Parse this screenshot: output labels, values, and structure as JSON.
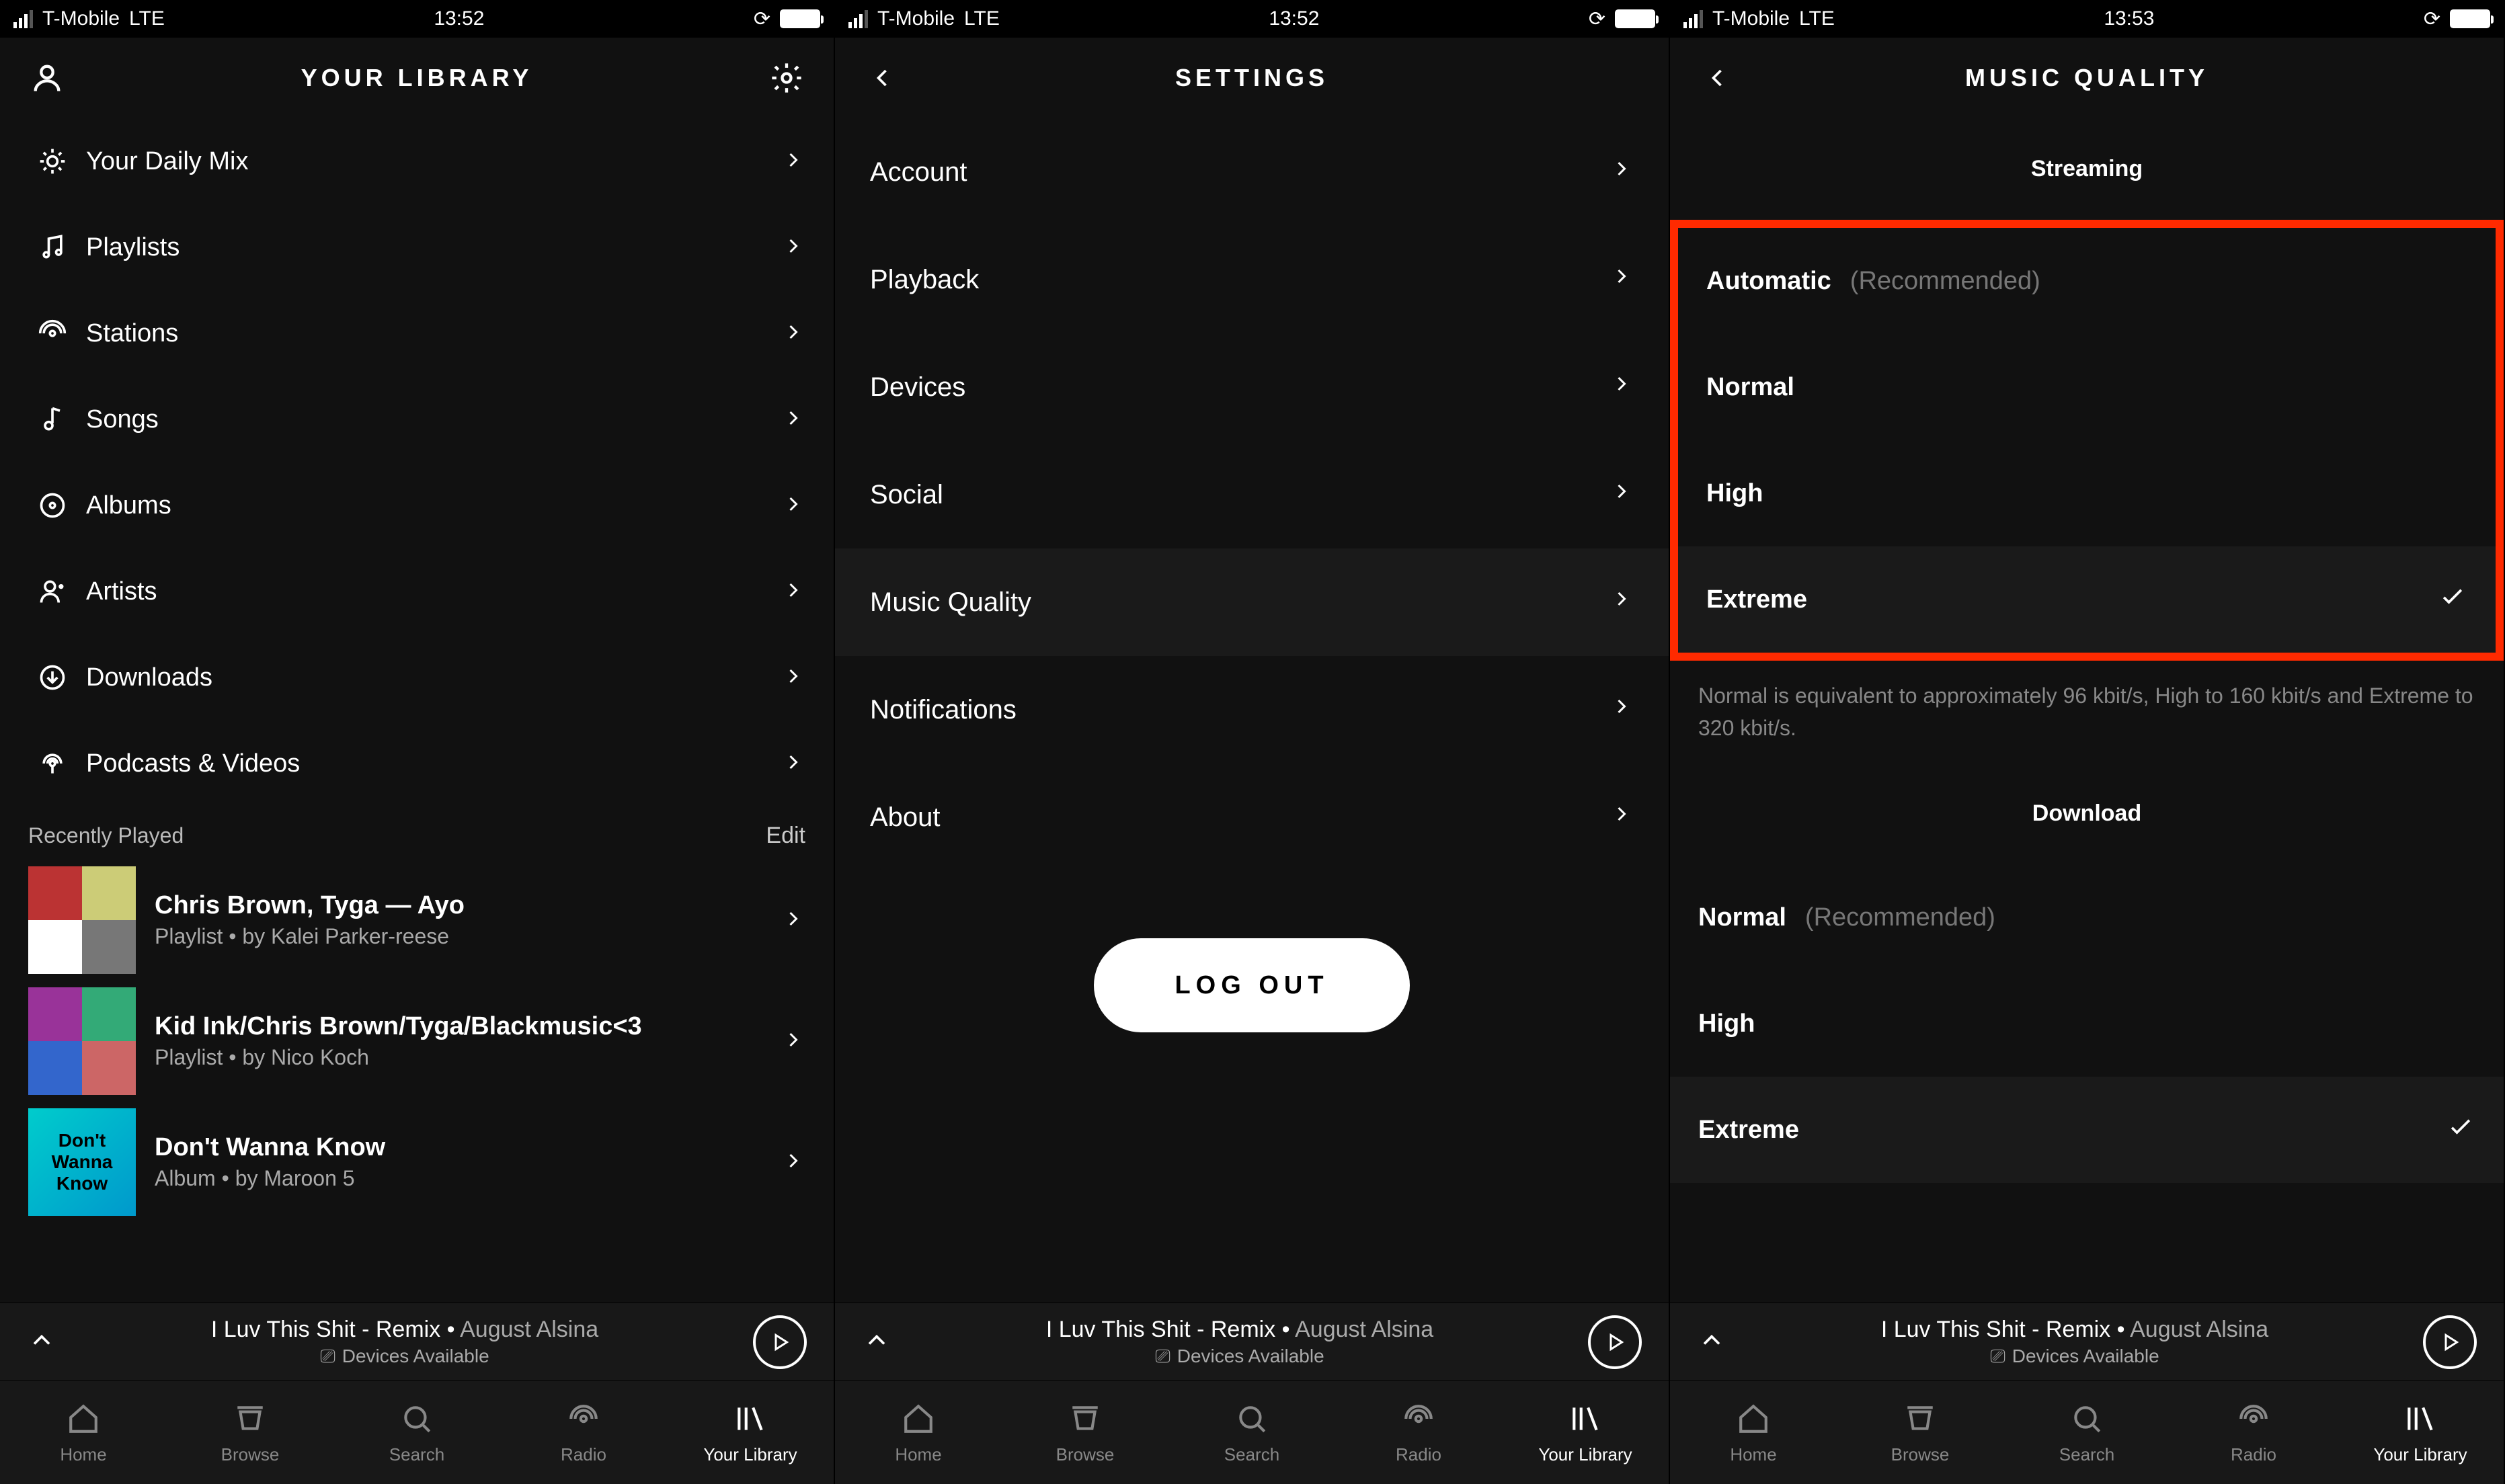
{
  "status": {
    "carrier": "T-Mobile",
    "network": "LTE",
    "time1": "13:52",
    "time2": "13:52",
    "time3": "13:53"
  },
  "screen1": {
    "title": "YOUR LIBRARY",
    "items": [
      {
        "label": "Your Daily Mix",
        "icon": "sun-icon"
      },
      {
        "label": "Playlists",
        "icon": "music-note-icon"
      },
      {
        "label": "Stations",
        "icon": "broadcast-icon"
      },
      {
        "label": "Songs",
        "icon": "note-icon"
      },
      {
        "label": "Albums",
        "icon": "disc-icon"
      },
      {
        "label": "Artists",
        "icon": "person-icon"
      },
      {
        "label": "Downloads",
        "icon": "download-icon"
      },
      {
        "label": "Podcasts & Videos",
        "icon": "podcast-icon"
      }
    ],
    "recently_played_label": "Recently Played",
    "edit_label": "Edit",
    "recent": [
      {
        "title": "Chris Brown, Tyga — Ayo",
        "sub": "Playlist • by Kalei Parker-reese"
      },
      {
        "title": "Kid Ink/Chris Brown/Tyga/Blackmusic<3",
        "sub": "Playlist • by Nico Koch"
      },
      {
        "title": "Don't Wanna Know",
        "sub": "Album • by Maroon 5"
      }
    ]
  },
  "screen2": {
    "title": "SETTINGS",
    "items": [
      {
        "label": "Account"
      },
      {
        "label": "Playback"
      },
      {
        "label": "Devices"
      },
      {
        "label": "Social"
      },
      {
        "label": "Music Quality",
        "active": true
      },
      {
        "label": "Notifications"
      },
      {
        "label": "About"
      }
    ],
    "logout": "LOG OUT"
  },
  "screen3": {
    "title": "MUSIC QUALITY",
    "streaming_label": "Streaming",
    "streaming_options": [
      {
        "label": "Automatic",
        "note": "(Recommended)"
      },
      {
        "label": "Normal"
      },
      {
        "label": "High"
      },
      {
        "label": "Extreme",
        "selected": true
      }
    ],
    "footnote": "Normal is equivalent to approximately 96 kbit/s, High to 160 kbit/s and Extreme to 320 kbit/s.",
    "download_label": "Download",
    "download_options": [
      {
        "label": "Normal",
        "note": "(Recommended)"
      },
      {
        "label": "High"
      },
      {
        "label": "Extreme",
        "selected": true
      }
    ]
  },
  "now_playing": {
    "title": "I Luv This Shit - Remix",
    "artist": "August Alsina",
    "devices": "Devices Available"
  },
  "tabs": [
    {
      "label": "Home"
    },
    {
      "label": "Browse"
    },
    {
      "label": "Search"
    },
    {
      "label": "Radio"
    },
    {
      "label": "Your Library",
      "active": true
    }
  ]
}
